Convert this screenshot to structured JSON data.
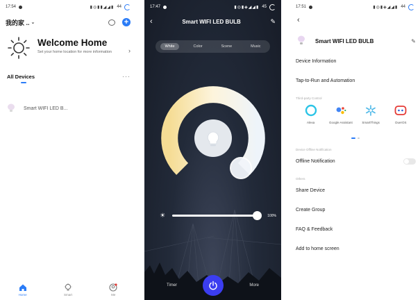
{
  "screens": {
    "home": {
      "status_time": "17:54",
      "status_battery": "44",
      "home_selector": "我的家 ..",
      "welcome_title": "Welcome Home",
      "welcome_subtitle": "Set your home location for more information",
      "all_devices_label": "All Devices",
      "more_label": "···",
      "devices": [
        {
          "name": "Smart WIFI LED B..."
        }
      ],
      "nav": [
        {
          "label": "Home",
          "icon": "home-icon"
        },
        {
          "label": "Smart",
          "icon": "bulb-icon"
        },
        {
          "label": "Me",
          "icon": "profile-icon"
        }
      ],
      "colors": {
        "accent": "#2b7cf7"
      }
    },
    "control": {
      "status_time": "17:47",
      "status_battery": "45",
      "title": "Smart WIFI LED BULB",
      "tabs": [
        {
          "label": "White",
          "active": true
        },
        {
          "label": "Color",
          "active": false
        },
        {
          "label": "Scene",
          "active": false
        },
        {
          "label": "Music",
          "active": false
        }
      ],
      "brightness_value": "100%",
      "brightness_fraction": 1.0,
      "timer_label": "Timer",
      "more_label": "More",
      "colors": {
        "power": "#3b3df0",
        "warm": "#f7e6b0",
        "cool": "#e8f0f8"
      }
    },
    "settings": {
      "status_time": "17:51",
      "status_battery": "44",
      "device_name": "Smart WIFI LED BULB",
      "device_information": "Device Information",
      "tap_to_run": "Tap-to-Run and Automation",
      "third_party_label": "Third-party Control",
      "third_party": [
        {
          "label": "Alexa",
          "icon": "alexa-icon"
        },
        {
          "label": "Google Assistant",
          "icon": "google-assistant-icon"
        },
        {
          "label": "SmartThings",
          "icon": "smartthings-icon"
        },
        {
          "label": "DuerOS",
          "icon": "dueros-icon"
        }
      ],
      "offline_section_label": "Device Offline Notification",
      "offline_notification": "Offline Notification",
      "others_label": "Others",
      "share_device": "Share Device",
      "create_group": "Create Group",
      "faq": "FAQ & Feedback",
      "add_to_home": "Add to home screen"
    }
  }
}
